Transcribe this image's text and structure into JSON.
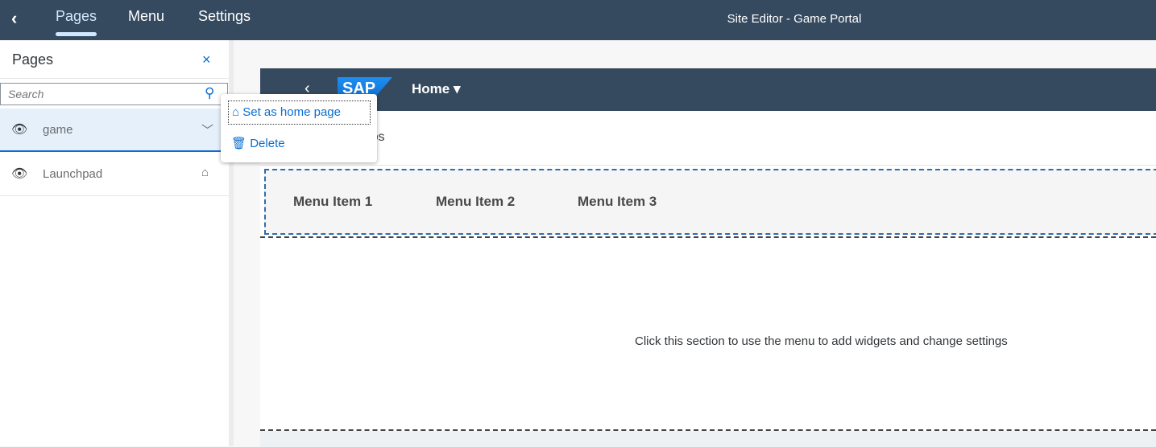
{
  "topbar": {
    "back": "‹",
    "tabs": [
      {
        "label": "Pages",
        "active": true
      },
      {
        "label": "Menu"
      },
      {
        "label": "Settings"
      }
    ],
    "title": "Site Editor - Game Portal"
  },
  "panel": {
    "title": "Pages",
    "close": "×",
    "search_placeholder": "Search",
    "pages": [
      {
        "label": "game",
        "selected": true
      },
      {
        "label": "Launchpad",
        "is_home": true
      }
    ]
  },
  "context_menu": {
    "items": [
      {
        "label": "Set as home page",
        "icon": "home-icon"
      },
      {
        "label": "Delete",
        "icon": "trash-icon"
      }
    ]
  },
  "preview": {
    "logo": "SAP",
    "nav": "Home ▾",
    "subtitle": "Apps",
    "menu_items": [
      "Menu Item 1",
      "Menu Item 2",
      "Menu Item 3"
    ],
    "section_hint": "Click this section to use the menu to add widgets and change settings"
  },
  "colors": {
    "shell": "#354a5f",
    "accent": "#0a6ed1"
  }
}
